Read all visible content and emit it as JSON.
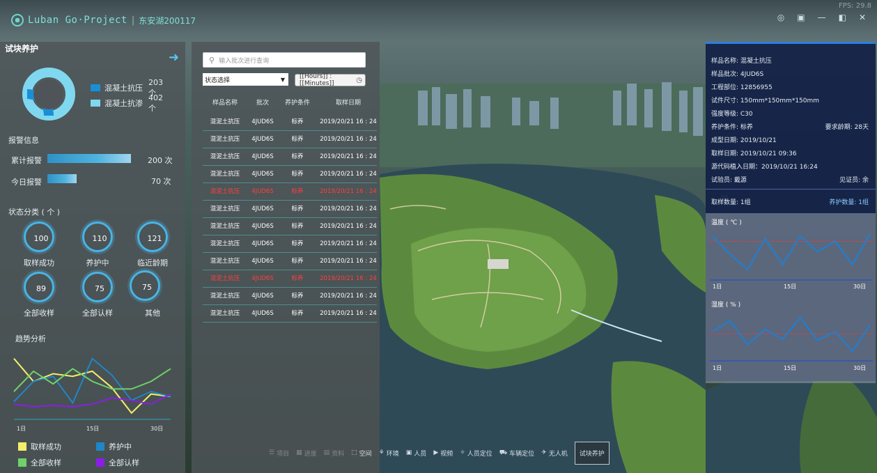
{
  "app": {
    "brand": "Luban Go·Project",
    "separator": "|",
    "project": "东安湖200117",
    "fps": "FPS: 29.8",
    "window_controls": [
      "◎",
      "▣",
      "—",
      "◧",
      "✕"
    ]
  },
  "left": {
    "title": "试块养护",
    "legend": [
      {
        "label": "混凝土抗压",
        "count": "203个",
        "color": "#1a8fd8"
      },
      {
        "label": "混凝土抗渗",
        "count": "402个",
        "color": "#7fd8ef"
      }
    ],
    "alarm": {
      "title": "报警信息",
      "rows": [
        {
          "label": "累计报警",
          "value": "200 次",
          "fill": 1.0
        },
        {
          "label": "今日报警",
          "value": "70 次",
          "fill": 0.35
        }
      ]
    },
    "status": {
      "title": "状态分类 ( 个 )",
      "items": [
        {
          "value": "100",
          "label": "取样成功"
        },
        {
          "value": "110",
          "label": "养护中"
        },
        {
          "value": "121",
          "label": "临近龄期"
        },
        {
          "value": "89",
          "label": "全部收样"
        },
        {
          "value": "75",
          "label": "全部认样"
        },
        {
          "value": "75",
          "label": "其他"
        }
      ]
    },
    "trend": {
      "title": "趋势分析",
      "legend": [
        {
          "label": "取样成功",
          "color": "#f5ee6a"
        },
        {
          "label": "养护中",
          "color": "#1f86c7"
        },
        {
          "label": "全部收样",
          "color": "#6fd16a"
        },
        {
          "label": "全部认样",
          "color": "#8a1ee6"
        }
      ]
    }
  },
  "list": {
    "search_placeholder": "输入批次进行查询",
    "status_select": "状态选择",
    "time_placeholder": "[[Hours]] : [[Minutes]]",
    "headers": [
      "样品名称",
      "批次",
      "养护条件",
      "取样日期"
    ],
    "rows": [
      {
        "name": "混泥土抗压",
        "batch": "4JUD6S",
        "cond": "标养",
        "date": "2019/20/21 16 : 24",
        "alert": false
      },
      {
        "name": "混泥土抗压",
        "batch": "4JUD6S",
        "cond": "标养",
        "date": "2019/20/21 16 : 24",
        "alert": false
      },
      {
        "name": "混泥土抗压",
        "batch": "4JUD6S",
        "cond": "标养",
        "date": "2019/20/21 16 : 24",
        "alert": false
      },
      {
        "name": "混泥土抗压",
        "batch": "4JUD6S",
        "cond": "标养",
        "date": "2019/20/21 16 : 24",
        "alert": false
      },
      {
        "name": "混泥土抗压",
        "batch": "4JUD6S",
        "cond": "标养",
        "date": "2019/20/21 16 : 24",
        "alert": true
      },
      {
        "name": "混泥土抗压",
        "batch": "4JUD6S",
        "cond": "标养",
        "date": "2019/20/21 16 : 24",
        "alert": false
      },
      {
        "name": "混泥土抗压",
        "batch": "4JUD6S",
        "cond": "标养",
        "date": "2019/20/21 16 : 24",
        "alert": false
      },
      {
        "name": "混泥土抗压",
        "batch": "4JUD6S",
        "cond": "标养",
        "date": "2019/20/21 16 : 24",
        "alert": false
      },
      {
        "name": "混泥土抗压",
        "batch": "4JUD6S",
        "cond": "标养",
        "date": "2019/20/21 16 : 24",
        "alert": false
      },
      {
        "name": "混泥土抗压",
        "batch": "4JUD6S",
        "cond": "标养",
        "date": "2019/20/21 16 : 24",
        "alert": true
      },
      {
        "name": "混泥土抗压",
        "batch": "4JUD6S",
        "cond": "标养",
        "date": "2019/20/21 16 : 24",
        "alert": false
      },
      {
        "name": "混泥土抗压",
        "batch": "4JUD6S",
        "cond": "标养",
        "date": "2019/20/21 16 : 24",
        "alert": false
      }
    ]
  },
  "toolbar": [
    {
      "icon": "☰",
      "label": "项目",
      "dim": true
    },
    {
      "icon": "▦",
      "label": "进度",
      "dim": true
    },
    {
      "icon": "▤",
      "label": "资料",
      "dim": true
    },
    {
      "icon": "⬚",
      "label": "空间",
      "dim": false
    },
    {
      "icon": "⚘",
      "label": "环境",
      "dim": false
    },
    {
      "icon": "▣",
      "label": "人员",
      "dim": false
    },
    {
      "icon": "▶",
      "label": "视频",
      "dim": false
    },
    {
      "icon": "✧",
      "label": "人员定位",
      "dim": false
    },
    {
      "icon": "⛟",
      "label": "车辆定位",
      "dim": false
    },
    {
      "icon": "✈",
      "label": "无人机",
      "dim": false
    },
    {
      "icon": "",
      "label": "试块养护",
      "active": true
    }
  ],
  "right": {
    "info": [
      "样品名称: 混凝土抗压",
      "样品批次: 4JUD6S",
      "工程部位: 12856955",
      "试件尺寸: 150mm*150mm*150mm",
      "强度等级: C30",
      "养护条件: 标养",
      "成型日期: 2019/10/21",
      "取样日期: 2019/10/21 09:36",
      "源代码植入日期：2019/10/21 16:24",
      "试验员: 戴源"
    ],
    "info_right": {
      "age": "要求龄期: 28天",
      "witness": "见证员: 余"
    },
    "qty": {
      "left": "取样数量: 1组",
      "right": "养护数量: 1组"
    },
    "temp_title": "温度 ( ℃ )",
    "humid_title": "湿度 ( % )",
    "ticks": [
      "1日",
      "15日",
      "30日"
    ]
  },
  "chart_data": [
    {
      "type": "line",
      "title": "趋势分析",
      "categories": [
        "1日",
        "15日",
        "30日"
      ],
      "series": [
        {
          "name": "取样成功",
          "values": [
            48,
            30,
            36,
            34,
            38,
            25,
            5,
            20,
            18
          ]
        },
        {
          "name": "养护中",
          "values": [
            14,
            30,
            34,
            13,
            48,
            35,
            15,
            22,
            18
          ]
        },
        {
          "name": "全部收样",
          "values": [
            22,
            38,
            28,
            40,
            30,
            24,
            24,
            30,
            40
          ]
        },
        {
          "name": "全部认样",
          "values": [
            12,
            10,
            11,
            10,
            12,
            17,
            15,
            12,
            20
          ]
        }
      ]
    },
    {
      "type": "line",
      "title": "温度 ( ℃ )",
      "categories": [
        "1日",
        "15日",
        "30日"
      ],
      "threshold": 30,
      "series": [
        {
          "values": [
            34,
            20,
            8,
            32,
            12,
            34,
            22,
            30,
            12,
            36
          ]
        }
      ]
    },
    {
      "type": "line",
      "title": "湿度 ( % )",
      "categories": [
        "1日",
        "15日",
        "30日"
      ],
      "threshold": 80,
      "series": [
        {
          "values": [
            82,
            92,
            70,
            84,
            75,
            95,
            74,
            82,
            64,
            88
          ]
        }
      ]
    }
  ]
}
